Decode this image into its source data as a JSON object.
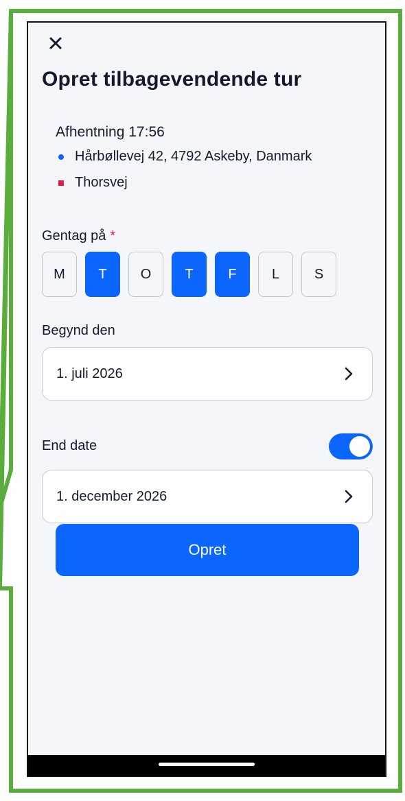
{
  "screen": {
    "title": "Opret tilbagevendende tur",
    "close_icon": "close-icon"
  },
  "trip": {
    "pickup_time": "Afhentning 17:56",
    "origin": "Hårbøllevej 42, 4792 Askeby, Danmark",
    "destination": "Thorsvej"
  },
  "repeat": {
    "label": "Gentag på",
    "required_mark": "*",
    "days": [
      {
        "label": "M",
        "selected": false
      },
      {
        "label": "T",
        "selected": true
      },
      {
        "label": "O",
        "selected": false
      },
      {
        "label": "T",
        "selected": true
      },
      {
        "label": "F",
        "selected": true
      },
      {
        "label": "L",
        "selected": false
      },
      {
        "label": "S",
        "selected": false
      }
    ]
  },
  "start": {
    "label": "Begynd den",
    "value": "1. juli 2026"
  },
  "end": {
    "label": "End date",
    "enabled": true,
    "value": "1. december 2026"
  },
  "actions": {
    "create_label": "Opret"
  },
  "colors": {
    "accent": "#0a66ff",
    "required": "#e6194b",
    "origin_marker": "#0a66ff",
    "destination_marker": "#e6194b",
    "annotation_outline": "#5aac3c"
  }
}
